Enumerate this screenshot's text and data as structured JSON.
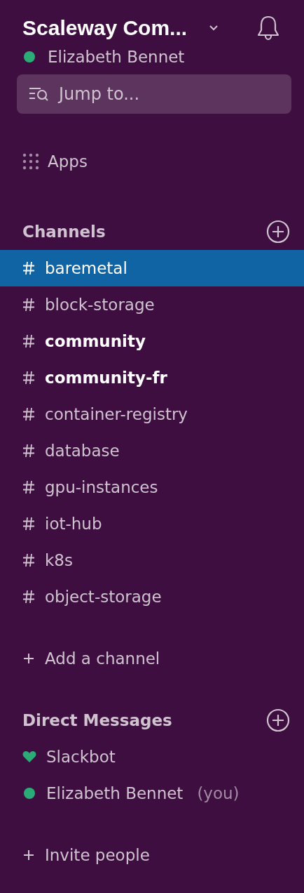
{
  "workspace": {
    "name": "Scaleway Com...",
    "user": "Elizabeth Bennet",
    "online": true
  },
  "search": {
    "placeholder": "Jump to..."
  },
  "apps": {
    "label": "Apps"
  },
  "channels": {
    "title": "Channels",
    "items": [
      {
        "name": "baremetal",
        "selected": true,
        "unread": false
      },
      {
        "name": "block-storage",
        "selected": false,
        "unread": false
      },
      {
        "name": "community",
        "selected": false,
        "unread": true
      },
      {
        "name": "community-fr",
        "selected": false,
        "unread": true
      },
      {
        "name": "container-registry",
        "selected": false,
        "unread": false
      },
      {
        "name": "database",
        "selected": false,
        "unread": false
      },
      {
        "name": "gpu-instances",
        "selected": false,
        "unread": false
      },
      {
        "name": "iot-hub",
        "selected": false,
        "unread": false
      },
      {
        "name": "k8s",
        "selected": false,
        "unread": false
      },
      {
        "name": "object-storage",
        "selected": false,
        "unread": false
      }
    ],
    "add": "Add a channel"
  },
  "direct_messages": {
    "title": "Direct Messages",
    "items": [
      {
        "name": "Slackbot",
        "kind": "bot",
        "color": "#2bac76"
      },
      {
        "name": "Elizabeth Bennet",
        "suffix": "(you)",
        "kind": "person",
        "color": "#2bac76"
      }
    ],
    "invite": "Invite people"
  }
}
